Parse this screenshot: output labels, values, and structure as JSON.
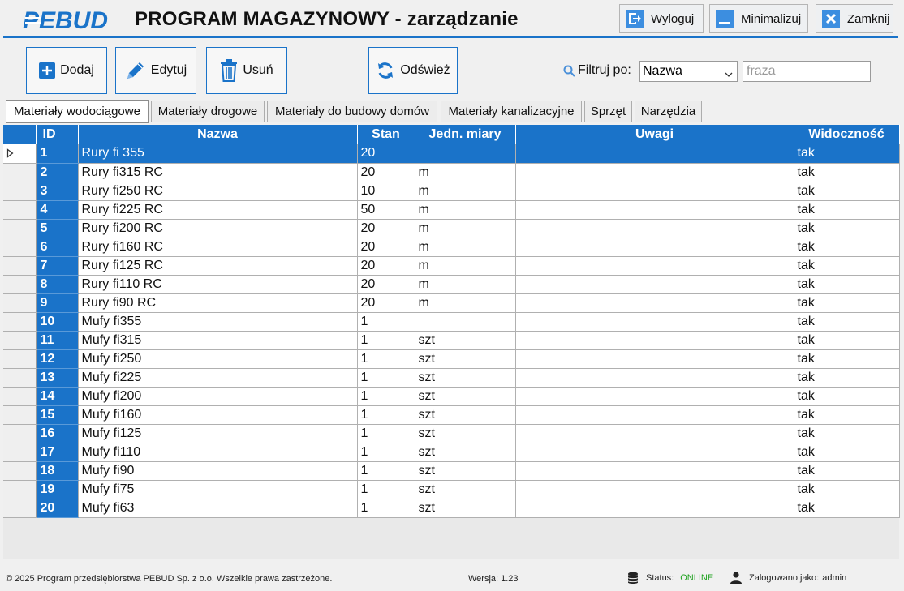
{
  "app": {
    "title": "PROGRAM MAGAZYNOWY - zarządzanie",
    "logo_text": "PEBUD",
    "accent_color": "#1a73c9"
  },
  "header_buttons": {
    "logout": "Wyloguj",
    "minimize": "Minimalizuj",
    "close": "Zamknij"
  },
  "toolbar": {
    "add": "Dodaj",
    "edit": "Edytuj",
    "delete": "Usuń",
    "refresh": "Odśwież"
  },
  "filter": {
    "label": "Filtruj po:",
    "selected": "Nazwa",
    "placeholder": "fraza"
  },
  "tabs": [
    {
      "label": "Materiały wodociągowe",
      "active": true
    },
    {
      "label": "Materiały drogowe",
      "active": false
    },
    {
      "label": "Materiały do budowy domów",
      "active": false
    },
    {
      "label": "Materiały kanalizacyjne",
      "active": false
    },
    {
      "label": "Sprzęt",
      "active": false
    },
    {
      "label": "Narzędzia",
      "active": false
    }
  ],
  "table": {
    "columns": [
      "ID",
      "Nazwa",
      "Stan",
      "Jedn. miary",
      "Uwagi",
      "Widoczność"
    ],
    "rows": [
      {
        "id": "1",
        "nazwa": "Rury fi 355",
        "stan": "20",
        "jm": "",
        "uwagi": "",
        "widocznosc": "tak"
      },
      {
        "id": "2",
        "nazwa": "Rury fi315 RC",
        "stan": "20",
        "jm": "m",
        "uwagi": "",
        "widocznosc": "tak"
      },
      {
        "id": "3",
        "nazwa": "Rury fi250 RC",
        "stan": "10",
        "jm": "m",
        "uwagi": "",
        "widocznosc": "tak"
      },
      {
        "id": "4",
        "nazwa": "Rury fi225 RC",
        "stan": "50",
        "jm": "m",
        "uwagi": "",
        "widocznosc": "tak"
      },
      {
        "id": "5",
        "nazwa": "Rury fi200 RC",
        "stan": "20",
        "jm": "m",
        "uwagi": "",
        "widocznosc": "tak"
      },
      {
        "id": "6",
        "nazwa": "Rury fi160 RC",
        "stan": "20",
        "jm": "m",
        "uwagi": "",
        "widocznosc": "tak"
      },
      {
        "id": "7",
        "nazwa": "Rury fi125 RC",
        "stan": "20",
        "jm": "m",
        "uwagi": "",
        "widocznosc": "tak"
      },
      {
        "id": "8",
        "nazwa": "Rury fi110 RC",
        "stan": "20",
        "jm": "m",
        "uwagi": "",
        "widocznosc": "tak"
      },
      {
        "id": "9",
        "nazwa": "Rury fi90 RC",
        "stan": "20",
        "jm": "m",
        "uwagi": "",
        "widocznosc": "tak"
      },
      {
        "id": "10",
        "nazwa": "Mufy fi355",
        "stan": "1",
        "jm": "",
        "uwagi": "",
        "widocznosc": "tak"
      },
      {
        "id": "11",
        "nazwa": "Mufy fi315",
        "stan": "1",
        "jm": "szt",
        "uwagi": "",
        "widocznosc": "tak"
      },
      {
        "id": "12",
        "nazwa": "Mufy fi250",
        "stan": "1",
        "jm": "szt",
        "uwagi": "",
        "widocznosc": "tak"
      },
      {
        "id": "13",
        "nazwa": "Mufy fi225",
        "stan": "1",
        "jm": "szt",
        "uwagi": "",
        "widocznosc": "tak"
      },
      {
        "id": "14",
        "nazwa": "Mufy fi200",
        "stan": "1",
        "jm": "szt",
        "uwagi": "",
        "widocznosc": "tak"
      },
      {
        "id": "15",
        "nazwa": "Mufy fi160",
        "stan": "1",
        "jm": "szt",
        "uwagi": "",
        "widocznosc": "tak"
      },
      {
        "id": "16",
        "nazwa": "Mufy fi125",
        "stan": "1",
        "jm": "szt",
        "uwagi": "",
        "widocznosc": "tak"
      },
      {
        "id": "17",
        "nazwa": "Mufy fi110",
        "stan": "1",
        "jm": "szt",
        "uwagi": "",
        "widocznosc": "tak"
      },
      {
        "id": "18",
        "nazwa": "Mufy fi90",
        "stan": "1",
        "jm": "szt",
        "uwagi": "",
        "widocznosc": "tak"
      },
      {
        "id": "19",
        "nazwa": "Mufy fi75",
        "stan": "1",
        "jm": "szt",
        "uwagi": "",
        "widocznosc": "tak"
      },
      {
        "id": "20",
        "nazwa": "Mufy fi63",
        "stan": "1",
        "jm": "szt",
        "uwagi": "",
        "widocznosc": "tak"
      }
    ]
  },
  "footer": {
    "copyright": "© 2025 Program przedsiębiorstwa PEBUD Sp. z o.o. Wszelkie prawa zastrzeżone.",
    "version": "Wersja: 1.23",
    "status_label": "Status:",
    "status_value": "ONLINE",
    "user_label": "Zalogowano jako:",
    "user_value": "admin"
  }
}
